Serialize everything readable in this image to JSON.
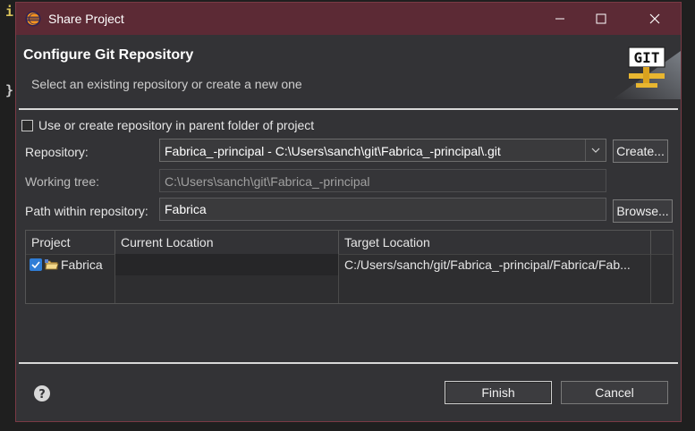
{
  "background": {
    "code_line_1": "i",
    "code_line_2": "}"
  },
  "window": {
    "title": "Share Project",
    "minimize_label": "Minimize",
    "maximize_label": "Maximize",
    "close_label": "Close"
  },
  "header": {
    "title": "Configure Git Repository",
    "subtitle": "Select an existing repository or create a new one",
    "banner_text": "GIT"
  },
  "form": {
    "use_parent_repo_label": "Use or create repository in parent folder of project",
    "use_parent_repo_checked": false,
    "repository_label": "Repository:",
    "repository_value": "Fabrica_-principal - C:\\Users\\sanch\\git\\Fabrica_-principal\\.git",
    "create_button": "Create...",
    "working_tree_label": "Working tree:",
    "working_tree_value": "C:\\Users\\sanch\\git\\Fabrica_-principal",
    "path_label": "Path within repository:",
    "path_value": "Fabrica",
    "browse_button": "Browse..."
  },
  "table": {
    "columns": [
      "Project",
      "Current Location",
      "Target Location"
    ],
    "rows": [
      {
        "checked": true,
        "project": "Fabrica",
        "current": "",
        "target": "C:/Users/sanch/git/Fabrica_-principal/Fabrica/Fab..."
      }
    ]
  },
  "footer": {
    "finish_button": "Finish",
    "cancel_button": "Cancel"
  },
  "colors": {
    "titlebar": "#5c2a35",
    "dialog_bg": "#333336",
    "checkbox_accent": "#2f7dd6"
  }
}
